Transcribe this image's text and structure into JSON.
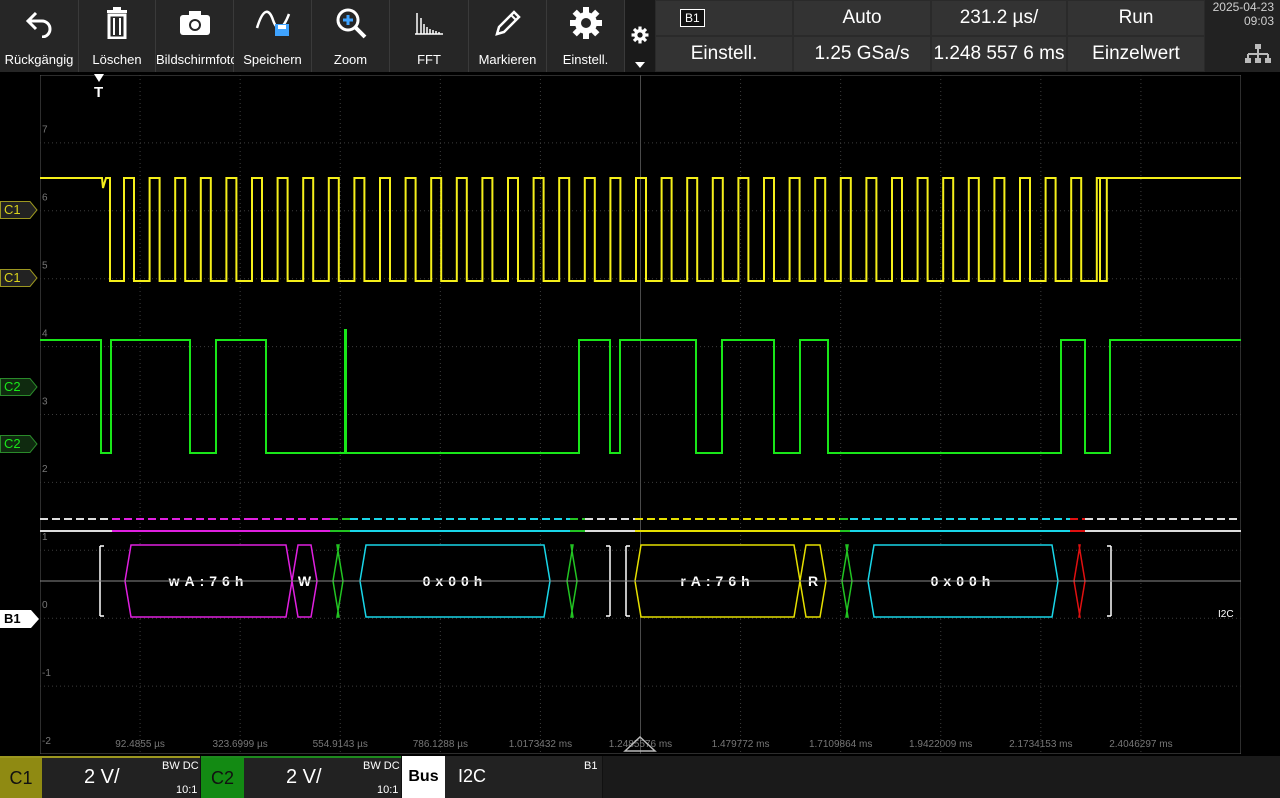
{
  "toolbar": {
    "buttons": [
      {
        "label": "Rückgängig",
        "icon": "undo-icon"
      },
      {
        "label": "Löschen",
        "icon": "trash-icon"
      },
      {
        "label": "Bildschirmfoto",
        "icon": "camera-icon"
      },
      {
        "label": "Speichern",
        "icon": "save-waveform-icon"
      },
      {
        "label": "Zoom",
        "icon": "zoom-icon"
      },
      {
        "label": "FFT",
        "icon": "fft-icon"
      },
      {
        "label": "Markieren",
        "icon": "pen-icon"
      },
      {
        "label": "Einstell.",
        "icon": "gear-icon"
      }
    ]
  },
  "header": {
    "bus_badge": "B1",
    "bus_settings": "Einstell.",
    "trigger_mode": "Auto",
    "sample_rate": "1.25 GSa/s",
    "time_scale": "231.2 µs/",
    "record_length": "1.248 557 6 ms",
    "run_state": "Run",
    "acq_mode": "Einzelwert"
  },
  "datetime": {
    "date": "2025-04-23",
    "time": "09:03"
  },
  "grid": {
    "y_labels": [
      "7",
      "6",
      "5",
      "4",
      "3",
      "2",
      "1",
      "0",
      "-1",
      "-2"
    ],
    "x_labels": [
      "92.4855 µs",
      "323.6999 µs",
      "554.9143 µs",
      "786.1288 µs",
      "1.0173432 ms",
      "1.2485576 ms",
      "1.479772 ms",
      "1.7109864 ms",
      "1.9422009 ms",
      "2.1734153 ms",
      "2.4046297 ms"
    ],
    "trigger_marker": "T",
    "bus_protocol_tag": "I2C"
  },
  "channel_tags": {
    "c1_trig": "C1",
    "c1": "C1",
    "c2_trig": "C2",
    "c2": "C2",
    "b1": "B1"
  },
  "decode": {
    "frames": [
      "wA:76h",
      "W",
      "0x00h",
      "rA:76h",
      "R",
      "0x00h"
    ]
  },
  "colors": {
    "ch1": "#f5ef1a",
    "ch2": "#19e619",
    "address": "#e020e0",
    "data": "#19d6e8",
    "read_addr": "#e6e000",
    "ack": "#22c422",
    "nack": "#e01010",
    "grid": "#5a5a5a"
  },
  "statusbar": {
    "c1_label": "C1",
    "c1_scale": "2 V/",
    "c1_bw": "BW DC",
    "c1_probe": "10:1",
    "c2_label": "C2",
    "c2_scale": "2 V/",
    "c2_bw": "BW DC",
    "c2_probe": "10:1",
    "bus_label": "Bus",
    "bus_protocol": "I2C",
    "bus_id": "B1"
  }
}
